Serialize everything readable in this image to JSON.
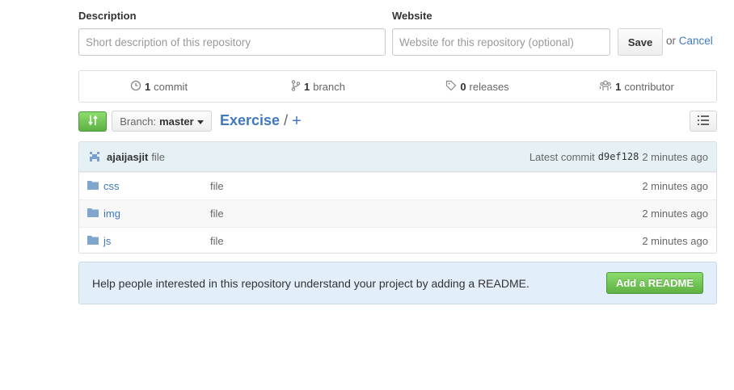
{
  "settings": {
    "description_label": "Description",
    "description_placeholder": "Short description of this repository",
    "website_label": "Website",
    "website_placeholder": "Website for this repository (optional)",
    "save_label": "Save",
    "or_text": "or",
    "cancel_label": "Cancel"
  },
  "summary": {
    "commits_count": "1",
    "commits_label": "commit",
    "branches_count": "1",
    "branches_label": "branch",
    "releases_count": "0",
    "releases_label": "releases",
    "contributors_count": "1",
    "contributors_label": "contributor"
  },
  "toolbar": {
    "branch_prefix": "Branch:",
    "branch_name": "master",
    "repo_name": "Exercise",
    "separator": "/",
    "add_file": "+"
  },
  "commit": {
    "author": "ajaijasjit",
    "message": "file",
    "latest_label": "Latest commit",
    "sha": "d9ef128",
    "time": "2 minutes ago"
  },
  "files": [
    {
      "name": "css",
      "message": "file",
      "age": "2 minutes ago"
    },
    {
      "name": "img",
      "message": "file",
      "age": "2 minutes ago"
    },
    {
      "name": "js",
      "message": "file",
      "age": "2 minutes ago"
    }
  ],
  "readme": {
    "text": "Help people interested in this repository understand your project by adding a README.",
    "button_label": "Add a README"
  },
  "colors": {
    "link": "#4078c0",
    "green": "#60b044",
    "commit_bar": "#e6f1f6",
    "readme_bg": "#e2eef9"
  }
}
